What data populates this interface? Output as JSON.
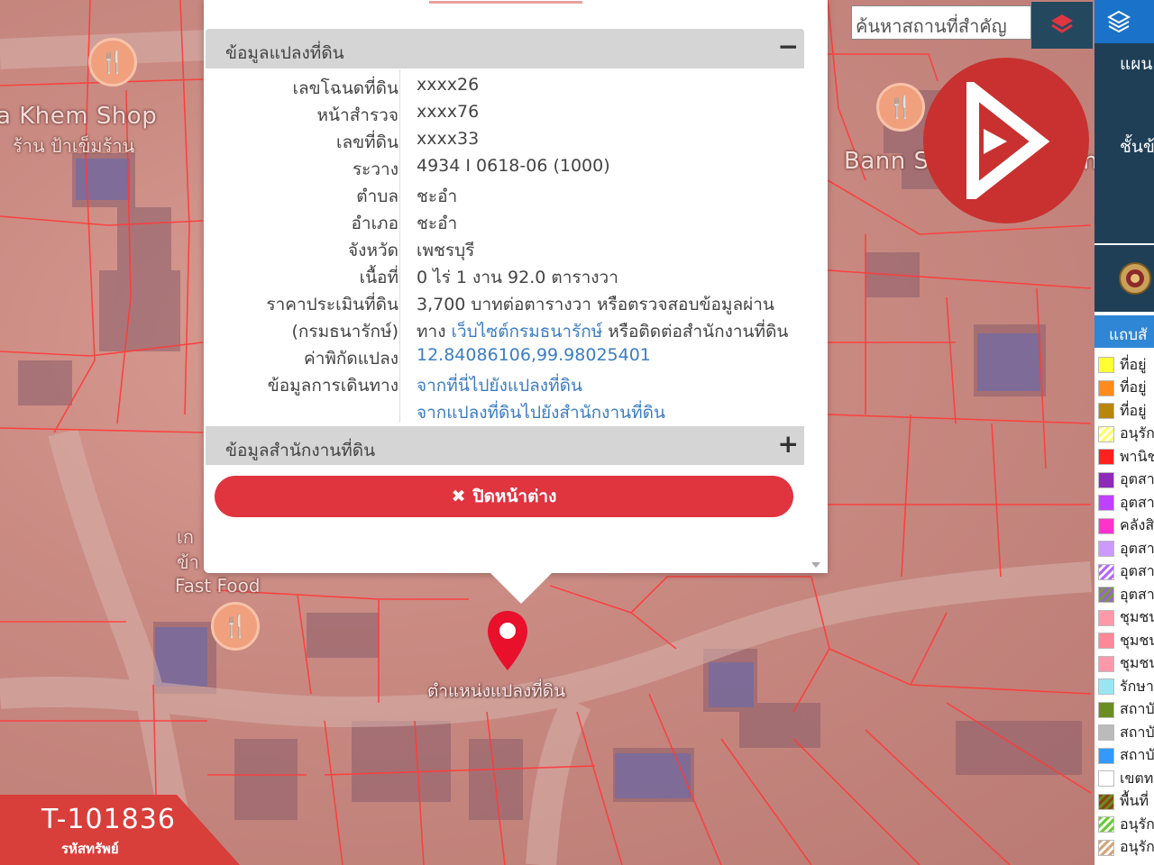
{
  "map": {
    "labels": {
      "shop_en": "a Khem Shop",
      "shop_th": "ร้าน ป้าเข็มร้าน",
      "restaurant": "Bann Som Restaurant",
      "fastfood_th": "เก",
      "fastfood_th2": "ข้า",
      "fastfood_en": "Fast Food"
    },
    "marker_label": "ตำแหน่งแปลงที่ดิน"
  },
  "popup": {
    "land_section": {
      "title": "ข้อมูลแปลงที่ดิน",
      "toggle": "−",
      "rows": [
        {
          "label": "เลขโฉนดที่ดิน",
          "value": "xxxx26"
        },
        {
          "label": "หน้าสำรวจ",
          "value": "xxxx76"
        },
        {
          "label": "เลขที่ดิน",
          "value": "xxxx33"
        },
        {
          "label": "ระวาง",
          "value": "4934 I 0618-06 (1000)"
        },
        {
          "label": "ตำบล",
          "value": "ชะอำ"
        },
        {
          "label": "อำเภอ",
          "value": "ชะอำ"
        },
        {
          "label": "จังหวัด",
          "value": "เพชรบุรี"
        },
        {
          "label": "เนื้อที่",
          "value": "0 ไร่ 1 งาน 92.0 ตารางวา"
        }
      ],
      "price": {
        "label_line1": "ราคาประเมินที่ดิน",
        "label_line2": "(กรมธนารักษ์)",
        "value_line1": "3,700 บาทต่อตารางวา หรือตรวจสอบข้อมูลผ่าน",
        "value_line2_prefix": "ทาง ",
        "value_line2_link": "เว็บไซต์กรมธนารักษ์",
        "value_line2_suffix": " หรือติดต่อสำนักงานที่ดิน"
      },
      "coords": {
        "label": "ค่าพิกัดแปลง",
        "value": "12.84086106,99.98025401"
      },
      "travel": {
        "label": "ข้อมูลการเดินทาง",
        "link1": "จากที่นี่ไปยังแปลงที่ดิน",
        "link2": "จากแปลงที่ดินไปยังสำนักงานที่ดิน"
      }
    },
    "office_section": {
      "title": "ข้อมูลสำนักงานที่ดิน",
      "toggle": "+"
    },
    "close_button": "ปิดหน้าต่าง"
  },
  "search": {
    "placeholder": "ค้นหาสถานที่สำคัญ"
  },
  "right_panel": {
    "line1": "แผน",
    "line2": "ชั้นข้",
    "legend_title": "แถบสั",
    "legend": [
      {
        "color": "#ffff33",
        "text": "ที่อยู่"
      },
      {
        "color": "#ff8c1a",
        "text": "ที่อยู่"
      },
      {
        "color": "#b8860b",
        "text": "ที่อยู่"
      },
      {
        "color": "#ffff66",
        "text": "อนุรัก",
        "pattern": "hatch-yellow"
      },
      {
        "color": "#ff2020",
        "text": "พานิช"
      },
      {
        "color": "#8e2bb8",
        "text": "อุตสา"
      },
      {
        "color": "#c040ff",
        "text": "อุตสา"
      },
      {
        "color": "#ff33cc",
        "text": "คลังสิ"
      },
      {
        "color": "#cc99ff",
        "text": "อุตสา"
      },
      {
        "color": "#b366ff",
        "text": "อุตสา",
        "pattern": "hatch-purple"
      },
      {
        "color": "#9966cc",
        "text": "อุตสา",
        "pattern": "hatch-purple2"
      },
      {
        "color": "#ff99aa",
        "text": "ชุมชน"
      },
      {
        "color": "#ff8899",
        "text": "ชุมชน"
      },
      {
        "color": "#ff99aa",
        "text": "ชุมชน"
      },
      {
        "color": "#99e6f2",
        "text": "รักษา"
      },
      {
        "color": "#6b8e23",
        "text": "สถาบั"
      },
      {
        "color": "#bbbbbb",
        "text": "สถาบั"
      },
      {
        "color": "#3399ff",
        "text": "สถาบั"
      },
      {
        "color": "#ffffff",
        "text": "เขตท"
      },
      {
        "color": "#8b4513",
        "text": "พื้นที่",
        "pattern": "hatch-brown"
      },
      {
        "color": "#66cc33",
        "text": "อนุรัก",
        "pattern": "hatch-green"
      },
      {
        "color": "#d2a679",
        "text": "อนุรัก",
        "pattern": "hatch-tan"
      }
    ]
  },
  "property": {
    "code": "T-101836",
    "caption": "รหัสทรัพย์"
  },
  "colors": {
    "accent_red": "#e0343f",
    "link_blue": "#3c7dc4",
    "panel_navy": "#1f3f57"
  }
}
